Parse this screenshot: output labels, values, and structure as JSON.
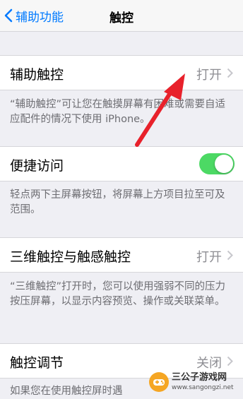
{
  "nav": {
    "back_label": "辅助功能",
    "title": "触控"
  },
  "assistive_touch": {
    "label": "辅助触控",
    "value": "打开",
    "description": "“辅助触控”可让您在触摸屏幕有困难或需要自适应配件的情况下使用 iPhone。"
  },
  "reachability": {
    "label": "便捷访问",
    "toggle_on": true,
    "description": "轻点两下主屏幕按钮，将屏幕上方项目拉至可及范围。"
  },
  "touch_3d": {
    "label": "三维触控与触感触控",
    "value": "打开",
    "description": "“三维触控”打开时，您可以使用强弱不同的压力按压屏幕，以显示内容预览、操作或关联菜单。"
  },
  "touch_accommodations": {
    "label": "触控调节",
    "value": "关闭",
    "description": "如果您在使用触控屏时遇"
  },
  "colors": {
    "accent": "#007aff",
    "toggle_on": "#4cd964",
    "annotation_arrow": "#e8212b"
  },
  "watermark": {
    "name": "三公子游戏网",
    "url": "www.sangongzi.net"
  }
}
